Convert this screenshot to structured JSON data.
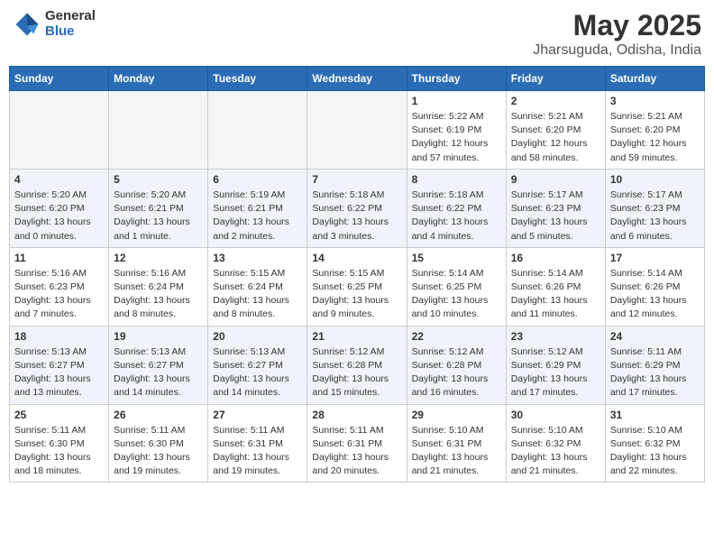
{
  "header": {
    "logo_general": "General",
    "logo_blue": "Blue",
    "month_title": "May 2025",
    "location": "Jharsuguda, Odisha, India"
  },
  "weekdays": [
    "Sunday",
    "Monday",
    "Tuesday",
    "Wednesday",
    "Thursday",
    "Friday",
    "Saturday"
  ],
  "weeks": [
    [
      {
        "day": "",
        "info": ""
      },
      {
        "day": "",
        "info": ""
      },
      {
        "day": "",
        "info": ""
      },
      {
        "day": "",
        "info": ""
      },
      {
        "day": "1",
        "info": "Sunrise: 5:22 AM\nSunset: 6:19 PM\nDaylight: 12 hours\nand 57 minutes."
      },
      {
        "day": "2",
        "info": "Sunrise: 5:21 AM\nSunset: 6:20 PM\nDaylight: 12 hours\nand 58 minutes."
      },
      {
        "day": "3",
        "info": "Sunrise: 5:21 AM\nSunset: 6:20 PM\nDaylight: 12 hours\nand 59 minutes."
      }
    ],
    [
      {
        "day": "4",
        "info": "Sunrise: 5:20 AM\nSunset: 6:20 PM\nDaylight: 13 hours\nand 0 minutes."
      },
      {
        "day": "5",
        "info": "Sunrise: 5:20 AM\nSunset: 6:21 PM\nDaylight: 13 hours\nand 1 minute."
      },
      {
        "day": "6",
        "info": "Sunrise: 5:19 AM\nSunset: 6:21 PM\nDaylight: 13 hours\nand 2 minutes."
      },
      {
        "day": "7",
        "info": "Sunrise: 5:18 AM\nSunset: 6:22 PM\nDaylight: 13 hours\nand 3 minutes."
      },
      {
        "day": "8",
        "info": "Sunrise: 5:18 AM\nSunset: 6:22 PM\nDaylight: 13 hours\nand 4 minutes."
      },
      {
        "day": "9",
        "info": "Sunrise: 5:17 AM\nSunset: 6:23 PM\nDaylight: 13 hours\nand 5 minutes."
      },
      {
        "day": "10",
        "info": "Sunrise: 5:17 AM\nSunset: 6:23 PM\nDaylight: 13 hours\nand 6 minutes."
      }
    ],
    [
      {
        "day": "11",
        "info": "Sunrise: 5:16 AM\nSunset: 6:23 PM\nDaylight: 13 hours\nand 7 minutes."
      },
      {
        "day": "12",
        "info": "Sunrise: 5:16 AM\nSunset: 6:24 PM\nDaylight: 13 hours\nand 8 minutes."
      },
      {
        "day": "13",
        "info": "Sunrise: 5:15 AM\nSunset: 6:24 PM\nDaylight: 13 hours\nand 8 minutes."
      },
      {
        "day": "14",
        "info": "Sunrise: 5:15 AM\nSunset: 6:25 PM\nDaylight: 13 hours\nand 9 minutes."
      },
      {
        "day": "15",
        "info": "Sunrise: 5:14 AM\nSunset: 6:25 PM\nDaylight: 13 hours\nand 10 minutes."
      },
      {
        "day": "16",
        "info": "Sunrise: 5:14 AM\nSunset: 6:26 PM\nDaylight: 13 hours\nand 11 minutes."
      },
      {
        "day": "17",
        "info": "Sunrise: 5:14 AM\nSunset: 6:26 PM\nDaylight: 13 hours\nand 12 minutes."
      }
    ],
    [
      {
        "day": "18",
        "info": "Sunrise: 5:13 AM\nSunset: 6:27 PM\nDaylight: 13 hours\nand 13 minutes."
      },
      {
        "day": "19",
        "info": "Sunrise: 5:13 AM\nSunset: 6:27 PM\nDaylight: 13 hours\nand 14 minutes."
      },
      {
        "day": "20",
        "info": "Sunrise: 5:13 AM\nSunset: 6:27 PM\nDaylight: 13 hours\nand 14 minutes."
      },
      {
        "day": "21",
        "info": "Sunrise: 5:12 AM\nSunset: 6:28 PM\nDaylight: 13 hours\nand 15 minutes."
      },
      {
        "day": "22",
        "info": "Sunrise: 5:12 AM\nSunset: 6:28 PM\nDaylight: 13 hours\nand 16 minutes."
      },
      {
        "day": "23",
        "info": "Sunrise: 5:12 AM\nSunset: 6:29 PM\nDaylight: 13 hours\nand 17 minutes."
      },
      {
        "day": "24",
        "info": "Sunrise: 5:11 AM\nSunset: 6:29 PM\nDaylight: 13 hours\nand 17 minutes."
      }
    ],
    [
      {
        "day": "25",
        "info": "Sunrise: 5:11 AM\nSunset: 6:30 PM\nDaylight: 13 hours\nand 18 minutes."
      },
      {
        "day": "26",
        "info": "Sunrise: 5:11 AM\nSunset: 6:30 PM\nDaylight: 13 hours\nand 19 minutes."
      },
      {
        "day": "27",
        "info": "Sunrise: 5:11 AM\nSunset: 6:31 PM\nDaylight: 13 hours\nand 19 minutes."
      },
      {
        "day": "28",
        "info": "Sunrise: 5:11 AM\nSunset: 6:31 PM\nDaylight: 13 hours\nand 20 minutes."
      },
      {
        "day": "29",
        "info": "Sunrise: 5:10 AM\nSunset: 6:31 PM\nDaylight: 13 hours\nand 21 minutes."
      },
      {
        "day": "30",
        "info": "Sunrise: 5:10 AM\nSunset: 6:32 PM\nDaylight: 13 hours\nand 21 minutes."
      },
      {
        "day": "31",
        "info": "Sunrise: 5:10 AM\nSunset: 6:32 PM\nDaylight: 13 hours\nand 22 minutes."
      }
    ]
  ]
}
